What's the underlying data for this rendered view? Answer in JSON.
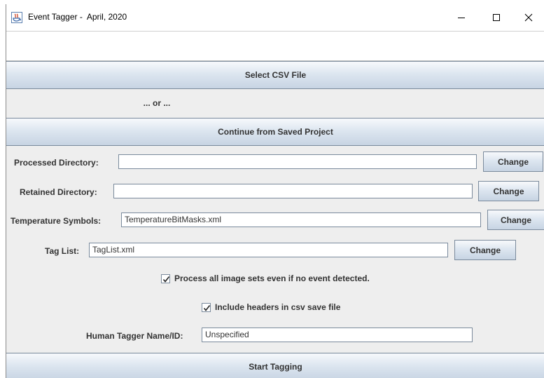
{
  "window": {
    "title": "Event Tagger -  April, 2020",
    "icon": "java-app-icon",
    "controls": [
      "minimize-icon",
      "maximize-icon",
      "close-icon"
    ]
  },
  "toolbar_field": {
    "value": ""
  },
  "buttons": {
    "select_csv": "Select CSV File",
    "or_label": "... or ...",
    "continue_saved": "Continue from Saved Project",
    "start_tagging": "Start Tagging"
  },
  "settings": {
    "processed_dir": {
      "label": "Processed Directory:",
      "value": "",
      "button": "Change"
    },
    "retained_dir": {
      "label": "Retained Directory:",
      "value": "",
      "button": "Change"
    },
    "temperature_symbols": {
      "label": "Temperature Symbols:",
      "value": "TemperatureBitMasks.xml",
      "button": "Change"
    },
    "tag_list": {
      "label": "Tag List:",
      "value": "TagList.xml",
      "button": "Change"
    }
  },
  "options": {
    "process_all": {
      "label": "Process all image sets even if no event detected.",
      "checked": true
    },
    "include_headers": {
      "label": "Include headers in csv save file",
      "checked": true
    }
  },
  "tagger": {
    "label": "Human Tagger Name/ID:",
    "value": "Unspecified"
  },
  "colors": {
    "accent_border": "#7a8a9c",
    "text": "#333333",
    "panel": "#eeeeee"
  }
}
